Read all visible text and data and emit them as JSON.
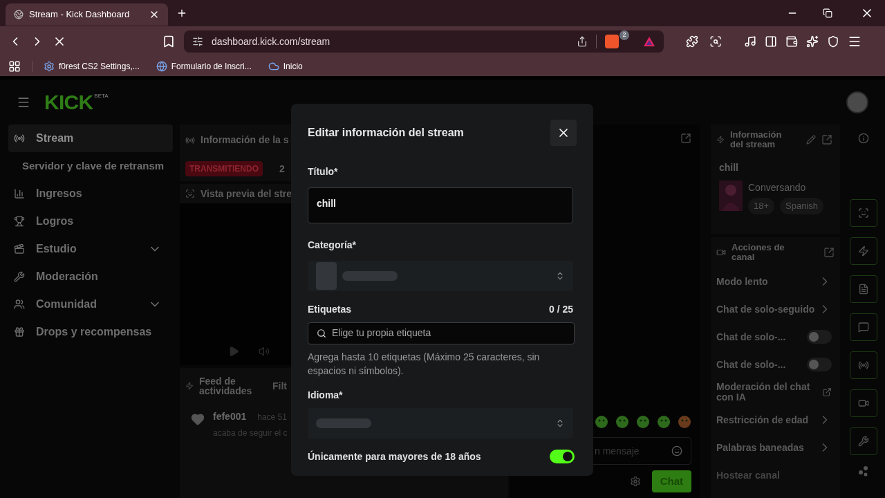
{
  "browser": {
    "tab_title": "Stream - Kick Dashboard",
    "url": "dashboard.kick.com/stream",
    "shield_count": "2",
    "bookmarks": [
      {
        "label": "f0rest CS2 Settings,...",
        "kind": "gear"
      },
      {
        "label": "Formulario de Inscri...",
        "kind": "globe"
      },
      {
        "label": "Inicio",
        "kind": "cloud"
      }
    ]
  },
  "app": {
    "logo": "KICK",
    "logo_badge": "BETA"
  },
  "sidebar": {
    "items": [
      {
        "label": "Stream",
        "selected": true,
        "expandable": false,
        "children": [
          {
            "label": "Servidor y clave de retransm",
            "selected": false
          }
        ]
      },
      {
        "label": "Ingresos",
        "selected": false,
        "expandable": false
      },
      {
        "label": "Logros",
        "selected": false,
        "expandable": false
      },
      {
        "label": "Estudio",
        "selected": false,
        "expandable": true
      },
      {
        "label": "Moderación",
        "selected": false,
        "expandable": false
      },
      {
        "label": "Comunidad",
        "selected": false,
        "expandable": true
      },
      {
        "label": "Drops y recompensas",
        "selected": false,
        "expandable": false
      }
    ]
  },
  "session": {
    "title": "Información de la s",
    "status": "TRANSMITIENDO",
    "count": "2"
  },
  "preview": {
    "title": "Vista previa del stre"
  },
  "feed": {
    "title": "Feed de actividades",
    "filter": "Filt",
    "events": [
      {
        "user": "fefe001",
        "time": "hace 51",
        "text": "acaba de seguir el c"
      }
    ]
  },
  "chat": {
    "placeholder": "n mensaje",
    "send": "Chat"
  },
  "stream_info": {
    "title": "Información del stream",
    "stream_title": "chill",
    "category": "Conversando",
    "tags": [
      "18+",
      "Spanish"
    ]
  },
  "channel_actions": {
    "title": "Acciones de canal",
    "items": [
      {
        "label": "Modo lento",
        "kind": "link"
      },
      {
        "label": "Chat de solo-seguido",
        "kind": "link"
      },
      {
        "label": "Chat de solo-...",
        "kind": "toggle",
        "on": false
      },
      {
        "label": "Chat de solo-...",
        "kind": "toggle",
        "on": false
      },
      {
        "label": "Moderación del chat con IA",
        "kind": "external"
      },
      {
        "label": "Restricción de edad",
        "kind": "link"
      },
      {
        "label": "Palabras baneadas",
        "kind": "link"
      },
      {
        "label": "Hostear canal",
        "kind": "faded"
      }
    ]
  },
  "modal": {
    "title": "Editar información del stream",
    "title_label": "Título*",
    "title_value": "chill",
    "category_label": "Categoría*",
    "tags_label": "Etiquetas",
    "tags_count": "0 / 25",
    "tags_placeholder": "Elige tu propia etiqueta",
    "tags_hint": "Agrega hasta 10 etiquetas (Máximo 25 caracteres, sin espacios ni símbolos).",
    "language_label": "Idioma*",
    "adult_label": "Únicamente para mayores de 18 años",
    "adult_on": true
  }
}
